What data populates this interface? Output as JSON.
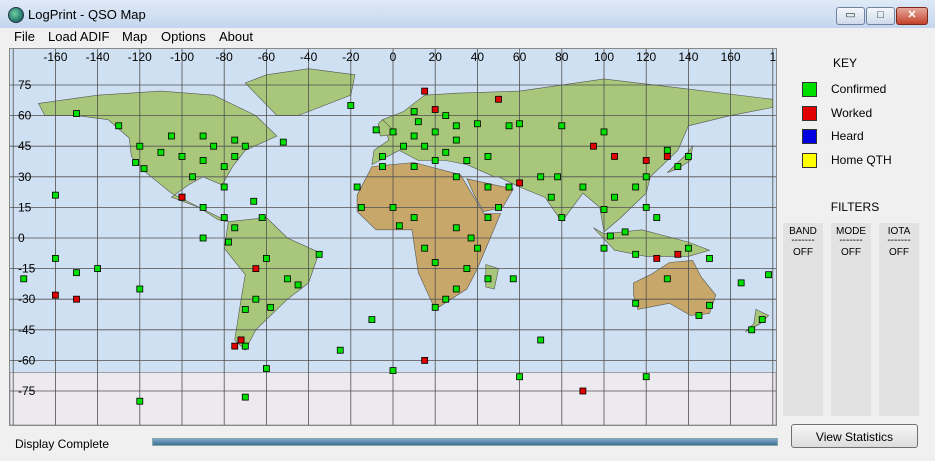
{
  "window": {
    "title": "LogPrint - QSO Map",
    "min_glyph": "▭",
    "max_glyph": "□",
    "close_glyph": "✕"
  },
  "menu": [
    "File",
    "Load ADIF",
    "Map",
    "Options",
    "About"
  ],
  "map": {
    "lon_ticks": [
      "-160",
      "-140",
      "-120",
      "-100",
      "-80",
      "-60",
      "-40",
      "-20",
      "0",
      "20",
      "40",
      "60",
      "80",
      "100",
      "120",
      "140",
      "160",
      "1"
    ],
    "lat_ticks": [
      "75",
      "60",
      "45",
      "30",
      "15",
      "0",
      "-15",
      "-30",
      "-45",
      "-60",
      "-75"
    ],
    "colors": {
      "ocean": "#cfe0f2",
      "land": "#a8c77a",
      "arid": "#c8a86a",
      "ice": "#ece9ef",
      "grid": "#505050"
    }
  },
  "qso_points": {
    "confirmed": [
      [
        -75,
        40
      ],
      [
        -80,
        35
      ],
      [
        -90,
        38
      ],
      [
        -100,
        40
      ],
      [
        -110,
        42
      ],
      [
        -120,
        45
      ],
      [
        -85,
        45
      ],
      [
        -95,
        30
      ],
      [
        -118,
        34
      ],
      [
        -122,
        37
      ],
      [
        -105,
        50
      ],
      [
        -90,
        50
      ],
      [
        -70,
        45
      ],
      [
        -75,
        48
      ],
      [
        -130,
        55
      ],
      [
        -150,
        61
      ],
      [
        -160,
        21
      ],
      [
        -100,
        20
      ],
      [
        -90,
        15
      ],
      [
        -80,
        10
      ],
      [
        -75,
        5
      ],
      [
        -60,
        -10
      ],
      [
        -50,
        -20
      ],
      [
        -65,
        -30
      ],
      [
        -70,
        -35
      ],
      [
        -58,
        -34
      ],
      [
        -72,
        -50
      ],
      [
        -70,
        -53
      ],
      [
        -45,
        -23
      ],
      [
        -35,
        -8
      ],
      [
        -78,
        -2
      ],
      [
        -90,
        0
      ],
      [
        -140,
        -15
      ],
      [
        -150,
        -17
      ],
      [
        -175,
        -20
      ],
      [
        -160,
        -10
      ],
      [
        -120,
        -25
      ],
      [
        0,
        52
      ],
      [
        10,
        50
      ],
      [
        20,
        52
      ],
      [
        30,
        55
      ],
      [
        40,
        56
      ],
      [
        15,
        45
      ],
      [
        5,
        45
      ],
      [
        -5,
        40
      ],
      [
        -8,
        53
      ],
      [
        -20,
        65
      ],
      [
        25,
        60
      ],
      [
        12,
        57
      ],
      [
        10,
        62
      ],
      [
        30,
        48
      ],
      [
        35,
        38
      ],
      [
        20,
        38
      ],
      [
        25,
        42
      ],
      [
        45,
        40
      ],
      [
        55,
        55
      ],
      [
        60,
        56
      ],
      [
        80,
        55
      ],
      [
        100,
        52
      ],
      [
        130,
        43
      ],
      [
        140,
        40
      ],
      [
        135,
        35
      ],
      [
        120,
        30
      ],
      [
        115,
        25
      ],
      [
        105,
        20
      ],
      [
        100,
        14
      ],
      [
        110,
        3
      ],
      [
        103,
        1
      ],
      [
        120,
        15
      ],
      [
        125,
        10
      ],
      [
        100,
        -5
      ],
      [
        115,
        -8
      ],
      [
        140,
        -5
      ],
      [
        150,
        -10
      ],
      [
        150,
        -33
      ],
      [
        145,
        -38
      ],
      [
        115,
        -32
      ],
      [
        130,
        -20
      ],
      [
        175,
        -40
      ],
      [
        170,
        -45
      ],
      [
        178,
        -18
      ],
      [
        165,
        -22
      ],
      [
        30,
        -25
      ],
      [
        25,
        -30
      ],
      [
        20,
        -34
      ],
      [
        35,
        -15
      ],
      [
        40,
        -5
      ],
      [
        37,
        0
      ],
      [
        30,
        5
      ],
      [
        10,
        10
      ],
      [
        0,
        15
      ],
      [
        -15,
        15
      ],
      [
        -17,
        25
      ],
      [
        -5,
        35
      ],
      [
        10,
        35
      ],
      [
        30,
        30
      ],
      [
        45,
        25
      ],
      [
        55,
        25
      ],
      [
        50,
        15
      ],
      [
        45,
        10
      ],
      [
        3,
        6
      ],
      [
        15,
        -5
      ],
      [
        20,
        -12
      ],
      [
        45,
        -20
      ],
      [
        57,
        -20
      ],
      [
        70,
        -50
      ],
      [
        -10,
        -40
      ],
      [
        -25,
        -55
      ],
      [
        0,
        -65
      ],
      [
        60,
        -68
      ],
      [
        120,
        -68
      ],
      [
        -60,
        -64
      ],
      [
        -70,
        -78
      ],
      [
        -120,
        -80
      ],
      [
        70,
        30
      ],
      [
        75,
        20
      ],
      [
        80,
        10
      ],
      [
        78,
        30
      ],
      [
        90,
        25
      ],
      [
        -52,
        47
      ],
      [
        -62,
        10
      ],
      [
        -80,
        25
      ],
      [
        -66,
        18
      ]
    ],
    "worked": [
      [
        -100,
        20
      ],
      [
        -65,
        -15
      ],
      [
        -72,
        -50
      ],
      [
        -160,
        -28
      ],
      [
        -150,
        -30
      ],
      [
        95,
        45
      ],
      [
        105,
        40
      ],
      [
        120,
        38
      ],
      [
        130,
        40
      ],
      [
        15,
        72
      ],
      [
        20,
        63
      ],
      [
        50,
        68
      ],
      [
        60,
        27
      ],
      [
        125,
        -10
      ],
      [
        135,
        -8
      ],
      [
        15,
        -60
      ],
      [
        90,
        -75
      ],
      [
        -75,
        -53
      ]
    ],
    "heard": []
  },
  "key": {
    "title": "KEY",
    "items": [
      {
        "label": "Confirmed",
        "color": "#00e000"
      },
      {
        "label": "Worked",
        "color": "#e00000"
      },
      {
        "label": "Heard",
        "color": "#0000e0"
      },
      {
        "label": "Home QTH",
        "color": "#ffff00"
      }
    ]
  },
  "filters": {
    "title": "FILTERS",
    "columns": [
      {
        "name": "BAND",
        "divider": "-------",
        "value": "OFF"
      },
      {
        "name": "MODE",
        "divider": "-------",
        "value": "OFF"
      },
      {
        "name": "IOTA",
        "divider": "-------",
        "value": "OFF"
      }
    ]
  },
  "status": {
    "text": "Display Complete",
    "progress": 1.0
  },
  "buttons": {
    "view_statistics": "View Statistics"
  }
}
